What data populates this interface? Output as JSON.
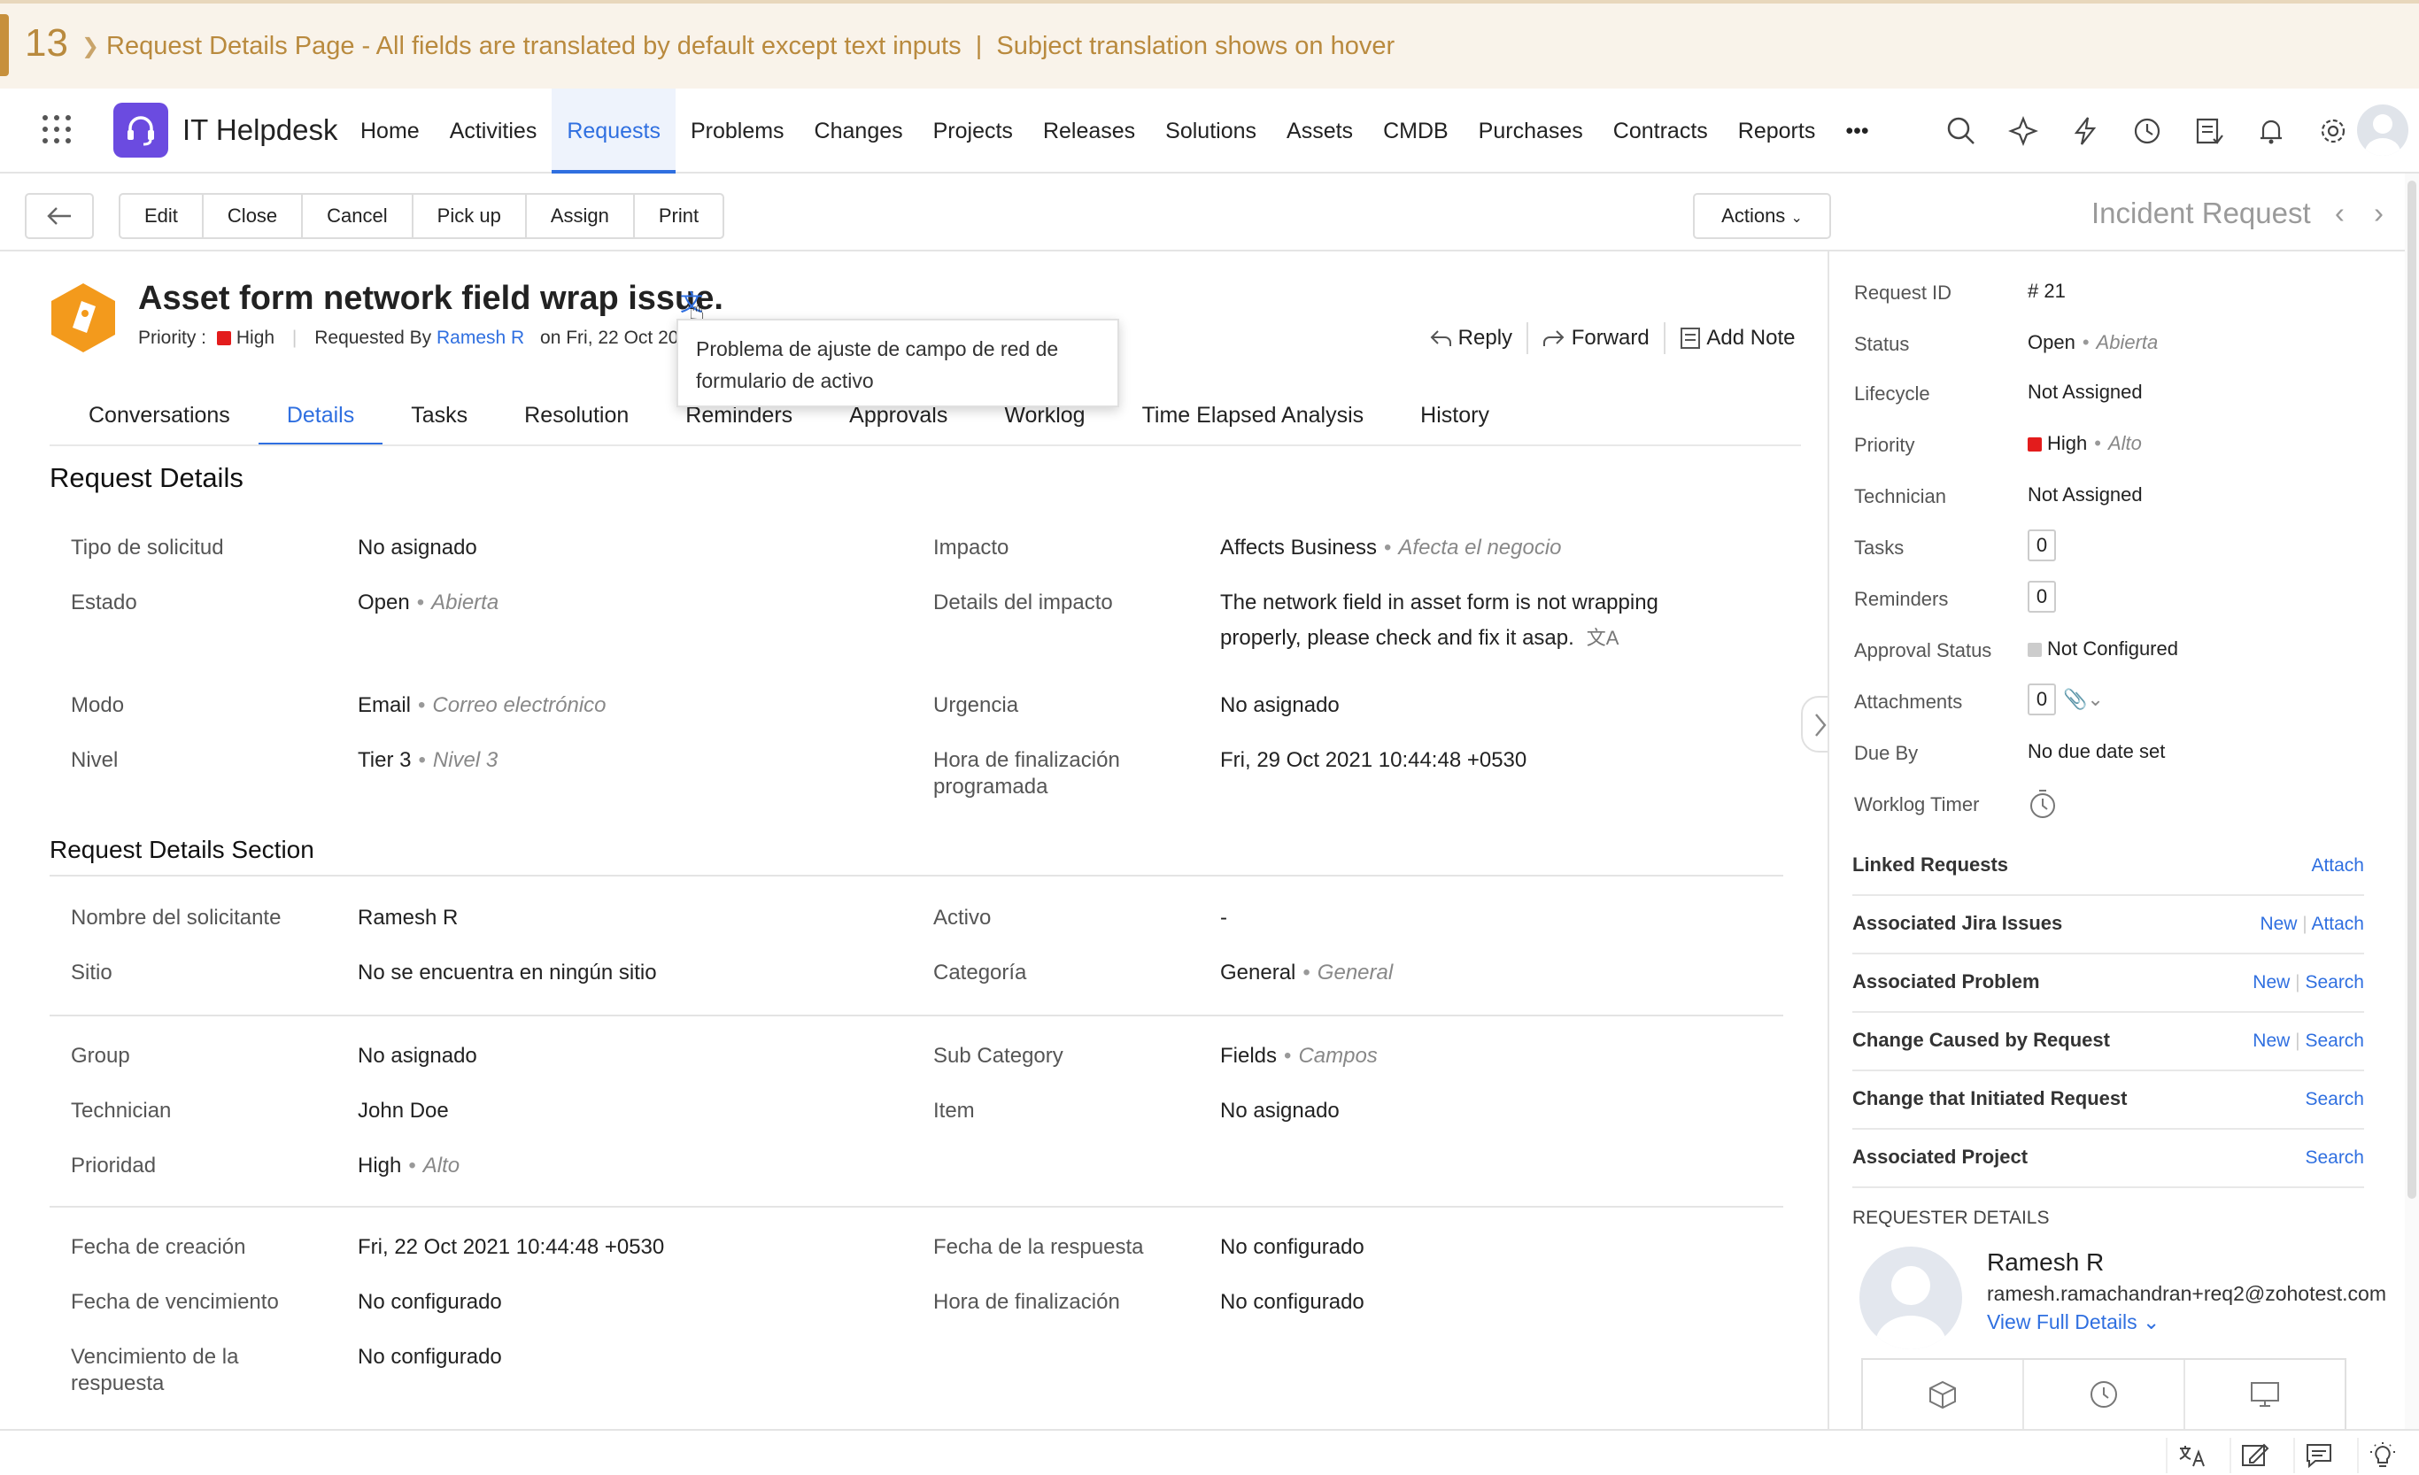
{
  "banner": {
    "number": "13",
    "text": "Request Details Page - All fields are translated by default except text inputs  |  Subject translation shows on hover"
  },
  "app": {
    "name": "IT Helpdesk"
  },
  "nav": [
    "Home",
    "Activities",
    "Requests",
    "Problems",
    "Changes",
    "Projects",
    "Releases",
    "Solutions",
    "Assets",
    "CMDB",
    "Purchases",
    "Contracts",
    "Reports",
    "•••"
  ],
  "toolbar": {
    "edit": "Edit",
    "close": "Close",
    "cancel": "Cancel",
    "pickup": "Pick up",
    "assign": "Assign",
    "print": "Print",
    "actions": "Actions",
    "type": "Incident Request"
  },
  "request": {
    "subject": "Asset form network field wrap issue.",
    "priority_label": "Priority :",
    "priority": "High",
    "requested_by_label": "Requested By",
    "requester": "Ramesh R",
    "on_date": "on Fri, 22 Oct 2021",
    "tooltip": "Problema de ajuste de campo de red de formulario de activo",
    "reply": "Reply",
    "forward": "Forward",
    "add_note": "Add Note"
  },
  "tabs": [
    "Conversations",
    "Details",
    "Tasks",
    "Resolution",
    "Reminders",
    "Approvals",
    "Worklog",
    "Time Elapsed Analysis",
    "History"
  ],
  "details": {
    "section1": "Request Details",
    "section2": "Request Details Section",
    "tipo_l": "Tipo de solicitud",
    "tipo_v": "No asignado",
    "estado_l": "Estado",
    "estado_v": "Open",
    "estado_t": "Abierta",
    "modo_l": "Modo",
    "modo_v": "Email",
    "modo_t": "Correo electrónico",
    "nivel_l": "Nivel",
    "nivel_v": "Tier 3",
    "nivel_t": "Nivel 3",
    "impacto_l": "Impacto",
    "impacto_v": "Affects Business",
    "impacto_t": "Afecta el negocio",
    "detimp_l": "Details del impacto",
    "detimp_v1": "The network field in asset form is not wrapping",
    "detimp_v2": "properly, please check and fix it asap.",
    "urgencia_l": "Urgencia",
    "urgencia_v": "No asignado",
    "horafin_l1": "Hora de finalización",
    "horafin_l2": "programada",
    "horafin_v": "Fri, 29 Oct 2021 10:44:48 +0530",
    "nombre_l": "Nombre del solicitante",
    "nombre_v": "Ramesh R",
    "sitio_l": "Sitio",
    "sitio_v": "No se encuentra en ningún sitio",
    "activo_l": "Activo",
    "activo_v": "-",
    "cat_l": "Categoría",
    "cat_v": "General",
    "cat_t": "General",
    "group_l": "Group",
    "group_v": "No asignado",
    "tech_l": "Technician",
    "tech_v": "John Doe",
    "prio_l": "Prioridad",
    "prio_v": "High",
    "prio_t": "Alto",
    "subcat_l": "Sub Category",
    "subcat_v": "Fields",
    "subcat_t": "Campos",
    "item_l": "Item",
    "item_v": "No asignado",
    "fcre_l": "Fecha de creación",
    "fcre_v": "Fri, 22 Oct 2021 10:44:48 +0530",
    "fven_l": "Fecha de vencimiento",
    "fven_v": "No configurado",
    "vres_l1": "Vencimiento de la",
    "vres_l2": "respuesta",
    "vres_v": "No configurado",
    "fres_l": "Fecha de la respuesta",
    "fres_v": "No configurado",
    "hfin_l": "Hora de finalización",
    "hfin_v": "No configurado"
  },
  "side": {
    "id_l": "Request ID",
    "id_v": "# 21",
    "status_l": "Status",
    "status_v": "Open",
    "status_t": "Abierta",
    "life_l": "Lifecycle",
    "life_v": "Not Assigned",
    "prio_l": "Priority",
    "prio_v": "High",
    "prio_t": "Alto",
    "tech_l": "Technician",
    "tech_v": "Not Assigned",
    "tasks_l": "Tasks",
    "tasks_v": "0",
    "rem_l": "Reminders",
    "rem_v": "0",
    "appr_l": "Approval Status",
    "appr_v": "Not Configured",
    "att_l": "Attachments",
    "att_v": "0",
    "due_l": "Due By",
    "due_v": "No due date set",
    "wt_l": "Worklog Timer",
    "linked": "Linked Requests",
    "attach": "Attach",
    "jira": "Associated Jira Issues",
    "new": "New",
    "search": "Search",
    "problem": "Associated Problem",
    "change_caused": "Change Caused by Request",
    "change_init": "Change that Initiated Request",
    "project": "Associated Project",
    "req_details": "REQUESTER DETAILS",
    "req_name": "Ramesh R",
    "req_mail": "ramesh.ramachandran+req2@zohotest.com",
    "view_full": "View Full Details"
  },
  "colors": {
    "accent": "#2f6fe0",
    "priority_high": "#e31c1c",
    "banner_text": "#b98a3e",
    "logo": "#6b4be0",
    "ticket": "#f39a1c"
  }
}
